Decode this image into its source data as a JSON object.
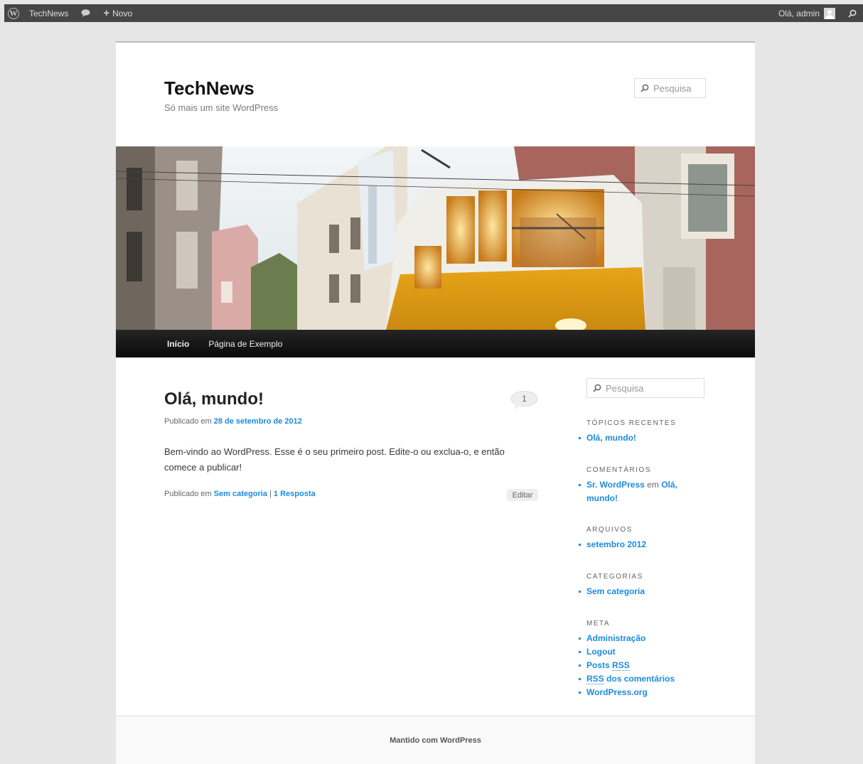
{
  "admin_bar": {
    "site_name": "TechNews",
    "new_label": "Novo",
    "greeting": "Olá, admin"
  },
  "site": {
    "title": "TechNews",
    "description": "Só mais um site WordPress"
  },
  "header_search": {
    "placeholder": "Pesquisa"
  },
  "nav": {
    "items": [
      {
        "label": "Início"
      },
      {
        "label": "Página de Exemplo"
      }
    ]
  },
  "post": {
    "title": "Olá, mundo!",
    "comment_count": "1",
    "meta_prefix": "Publicado em",
    "date": "28 de setembro de 2012",
    "content": "Bem-vindo ao WordPress. Esse é o seu primeiro post. Edite-o ou exclua-o, e então comece a publicar!",
    "footer_prefix": "Publicado em",
    "category": "Sem categoria",
    "separator": "|",
    "replies": "1 Resposta",
    "edit_label": "Editar"
  },
  "sidebar": {
    "search_placeholder": "Pesquisa",
    "recent_posts": {
      "title": "Tópicos recentes",
      "items": [
        "Olá, mundo!"
      ]
    },
    "comments": {
      "title": "Comentários",
      "author": "Sr. WordPress",
      "connector": "em",
      "post": "Olá, mundo!"
    },
    "archives": {
      "title": "Arquivos",
      "items": [
        "setembro 2012"
      ]
    },
    "categories": {
      "title": "Categorias",
      "items": [
        "Sem categoria"
      ]
    },
    "meta": {
      "title": "Meta",
      "items": [
        "Administração",
        "Logout",
        "Posts",
        "RSS",
        "RSS",
        "dos comentários",
        "WordPress.org"
      ]
    }
  },
  "footer": {
    "text": "Mantido com WordPress"
  }
}
